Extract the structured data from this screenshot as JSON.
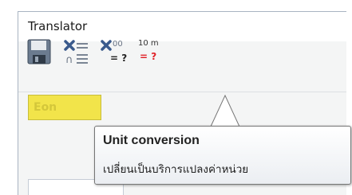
{
  "window": {
    "title": "Translator"
  },
  "toolbar": {
    "buttons": [
      {
        "name": "save",
        "icon": "floppy-disk-icon"
      },
      {
        "name": "clear-text",
        "icon": "clear-text-icon"
      },
      {
        "name": "clear-numbers",
        "icon": "clear-numbers-icon"
      },
      {
        "name": "unit-conversion",
        "icon": "unit-conversion-icon",
        "top_label": "10 m",
        "bottom_label": "= ?"
      }
    ],
    "clear_numbers_top": "00",
    "clear_numbers_bottom": "= ?"
  },
  "field": {
    "value": "Eon"
  },
  "tooltip": {
    "title": "Unit conversion",
    "description": "เปลี่ยนเป็นบริการแปลงค่าหน่วย"
  },
  "colors": {
    "field_highlight": "#f2e44a",
    "icon_blue": "#3a5a8c",
    "unit_red": "#e0242a",
    "tooltip_border": "#767676"
  }
}
